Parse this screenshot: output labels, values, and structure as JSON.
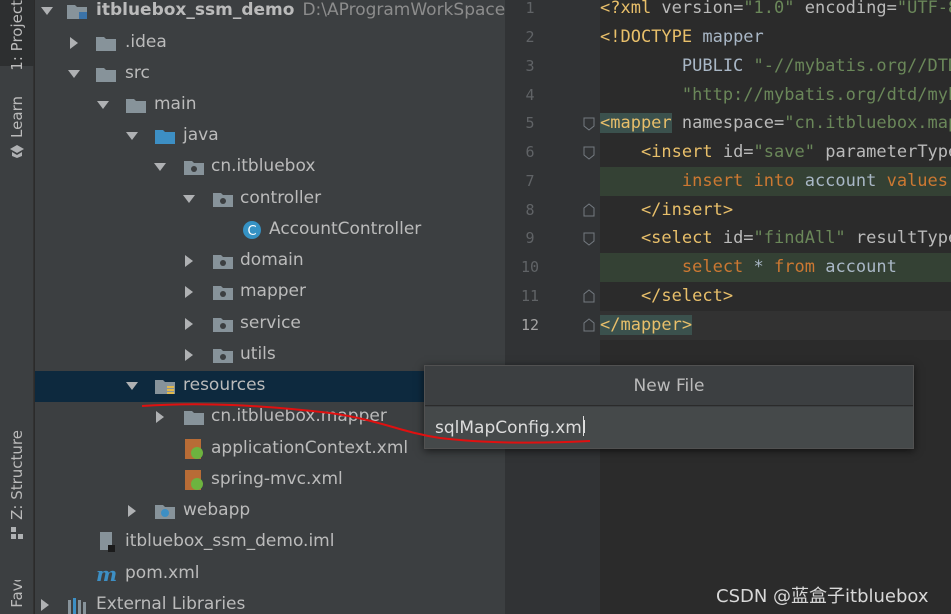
{
  "toolwindow": {
    "project_tab": "1: Project",
    "learn_tab": "Learn",
    "structure_tab": "Z: Structure",
    "favorites_tab": "Favorites"
  },
  "tree": {
    "root_name": "itbluebox_ssm_demo",
    "root_path": "D:\\AProgramWorkSpace\\idea",
    "idea": ".idea",
    "src": "src",
    "main": "main",
    "java": "java",
    "pkg": "cn.itbluebox",
    "controller": "controller",
    "account_controller": "AccountController",
    "domain": "domain",
    "mapper": "mapper",
    "service": "service",
    "utils": "utils",
    "resources": "resources",
    "res_mapper": "cn.itbluebox.mapper",
    "app_ctx": "applicationContext.xml",
    "spring_mvc": "spring-mvc.xml",
    "webapp": "webapp",
    "iml": "itbluebox_ssm_demo.iml",
    "pom": "pom.xml",
    "ext_libs": "External Libraries"
  },
  "editor": {
    "line_numbers": [
      "1",
      "2",
      "3",
      "4",
      "5",
      "6",
      "7",
      "8",
      "9",
      "10",
      "11",
      "12"
    ],
    "current_line": "12"
  },
  "dialog": {
    "title": "New File",
    "value": "sqlMapConfig.xml"
  },
  "watermark": "CSDN @蓝盒子itbluebox",
  "colors": {
    "tag": "#e8bf6a",
    "attr": "#bababa",
    "string": "#6a8759",
    "keyword": "#cc7832",
    "sql_keyword": "#cc7832",
    "plain": "#a9b7c6",
    "selection": "#0d293e",
    "annotation_red": "#e01010"
  }
}
